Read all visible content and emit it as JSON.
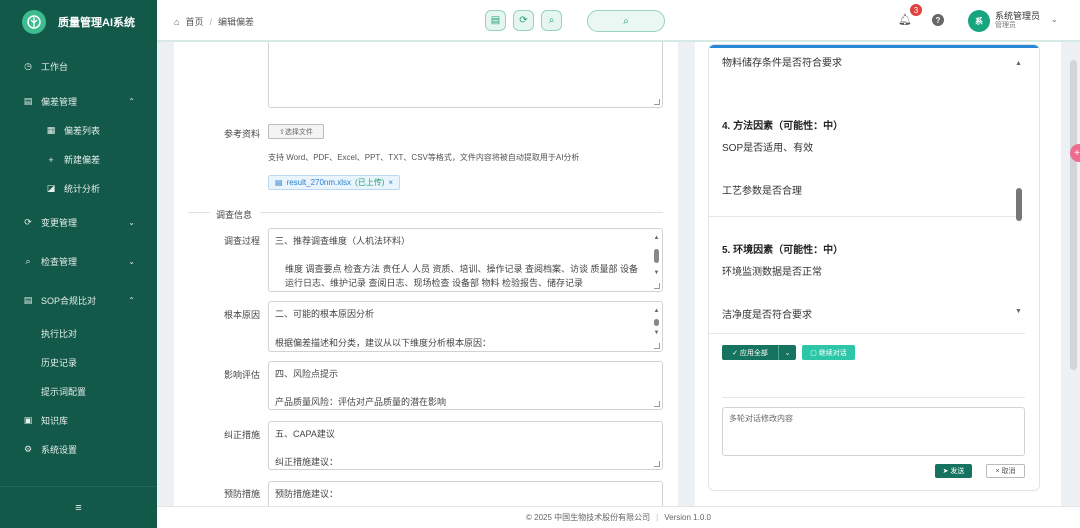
{
  "app": {
    "title": "质量管理AI系统"
  },
  "sidebar": {
    "items": [
      {
        "label": "工作台",
        "icon": "dashboard-icon"
      },
      {
        "label": "偏差管理",
        "icon": "document-icon"
      },
      {
        "label": "偏差列表",
        "icon": "list-icon"
      },
      {
        "label": "新建偏差",
        "icon": "plus-icon"
      },
      {
        "label": "统计分析",
        "icon": "chart-icon"
      },
      {
        "label": "变更管理",
        "icon": "change-icon"
      },
      {
        "label": "检查管理",
        "icon": "search-icon"
      },
      {
        "label": "SOP合规比对",
        "icon": "document-icon"
      },
      {
        "label": "执行比对"
      },
      {
        "label": "历史记录"
      },
      {
        "label": "提示词配置"
      },
      {
        "label": "知识库",
        "icon": "book-icon"
      },
      {
        "label": "系统设置",
        "icon": "gear-icon"
      }
    ],
    "collapse_icon": "≡"
  },
  "header": {
    "breadcrumb": [
      "首页",
      "编辑偏差"
    ],
    "badge_count": "3",
    "user_avatar": "系",
    "user_name": "系统管理员",
    "user_role": "管理员"
  },
  "form": {
    "ref_label": "参考资料",
    "file_button": "⇧选择文件",
    "hint": "支持 Word、PDF、Excel、PPT、TXT、CSV等格式，文件内容将被自动提取用于AI分析",
    "file_name": "result_270nm.xlsx",
    "file_status": "(已上传)",
    "section_title": "调查信息",
    "fields": [
      {
        "label": "调查过程",
        "lines": [
          "三、推荐调查维度（人机法环料）",
          "",
          "维度   调查要点   检查方法   责任人   人员   资质、培训、操作记录   查阅档案、访谈   质量部   设备   运行日志、维护记录   查阅日志、现场检查   设备部   物料   检验报告、储存记录"
        ]
      },
      {
        "label": "根本原因",
        "lines": [
          "二、可能的根本原因分析",
          "",
          "根据偏差描述和分类，建议从以下维度分析根本原因："
        ]
      },
      {
        "label": "影响评估",
        "lines": [
          "四、风险点提示",
          "",
          "产品质量风险：评估对产品质量的潜在影响"
        ]
      },
      {
        "label": "纠正措施",
        "lines": [
          "五、CAPA建议",
          "",
          "纠正措施建议："
        ]
      },
      {
        "label": "预防措施",
        "lines": [
          "预防措施建议："
        ]
      }
    ]
  },
  "ai": {
    "top_text": "物料储存条件是否符合要求",
    "h1": "4. 方法因素（可能性：中）",
    "t1": "SOP是否适用、有效",
    "t2": "工艺参数是否合理",
    "h2": "5. 环境因素（可能性：中）",
    "t3": "环境监测数据是否正常",
    "t4": "洁净度是否符合要求",
    "apply_label": "应用全部",
    "continue_label": "继续对话",
    "input_placeholder": "多轮对话修改内容",
    "send_label": "发送",
    "cancel_label": "取消"
  },
  "footer": {
    "copyright": "© 2025 中国生物技术股份有限公司",
    "version": "Version 1.0.0"
  },
  "colors": {
    "sidebar": "#12594a",
    "accent": "#16735f",
    "brand_green": "#3dbd8f"
  }
}
